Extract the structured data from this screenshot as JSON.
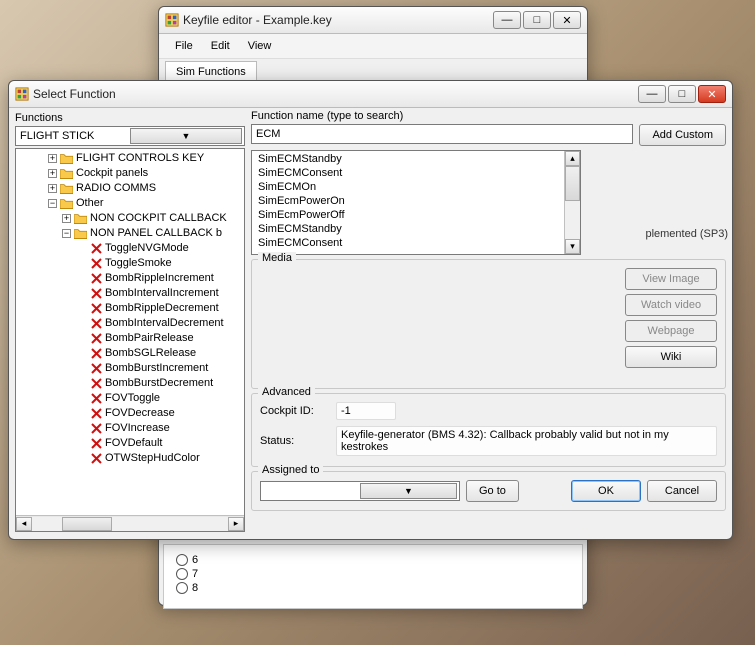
{
  "back_window": {
    "title": "Keyfile editor - Example.key",
    "menu": {
      "file": "File",
      "edit": "Edit",
      "view": "View"
    },
    "tab": "Sim Functions",
    "radios": [
      "6",
      "7",
      "8"
    ]
  },
  "front_window": {
    "title": "Select Function",
    "functions_label": "Functions",
    "flight_stick": "FLIGHT STICK",
    "tree": {
      "flight_controls": "FLIGHT CONTROLS KEY",
      "cockpit_panels": "Cockpit panels",
      "radio_comms": "RADIO COMMS",
      "other": "Other",
      "non_cockpit": "NON COCKPIT CALLBACK",
      "non_panel": "NON PANEL CALLBACK b",
      "items": [
        "ToggleNVGMode",
        "ToggleSmoke",
        "BombRippleIncrement",
        "BombIntervalIncrement",
        "BombRippleDecrement",
        "BombIntervalDecrement",
        "BombPairRelease",
        "BombSGLRelease",
        "BombBurstIncrement",
        "BombBurstDecrement",
        "FOVToggle",
        "FOVDecrease",
        "FOVIncrease",
        "FOVDefault",
        "OTWStepHudColor"
      ]
    },
    "fname_label": "Function name (type to search)",
    "search_value": "ECM",
    "add_custom": "Add Custom",
    "list": [
      "SimECMStandby",
      "SimECMConsent",
      "SimECMOn",
      "SimEcmPowerOn",
      "SimEcmPowerOff",
      "SimECMStandby",
      "SimECMConsent"
    ],
    "peek_text": "plemented (SP3)",
    "media": {
      "legend": "Media",
      "view_image": "View Image",
      "watch_video": "Watch video",
      "webpage": "Webpage",
      "wiki": "Wiki"
    },
    "advanced": {
      "legend": "Advanced",
      "cockpit_label": "Cockpit ID:",
      "cockpit_val": "-1",
      "status_label": "Status:",
      "status_val": "Keyfile-generator (BMS 4.32): Callback probably valid but not in my kestrokes"
    },
    "assigned_to": "Assigned to",
    "goto": "Go to",
    "ok": "OK",
    "cancel": "Cancel"
  }
}
